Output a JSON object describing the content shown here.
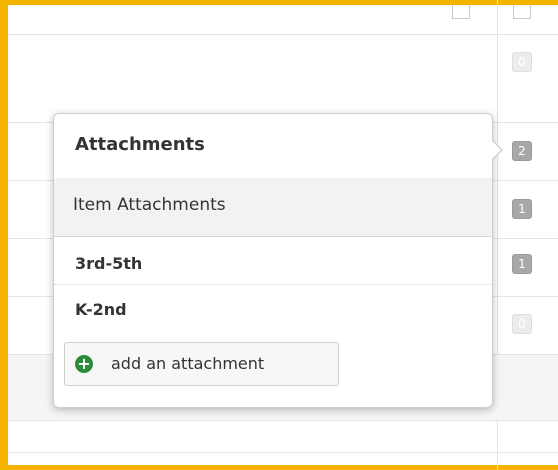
{
  "popover": {
    "title": "Attachments",
    "section_label": "Item Attachments",
    "items": [
      {
        "label": "3rd-5th"
      },
      {
        "label": "K-2nd"
      }
    ],
    "add_button_label": "add an attachment",
    "add_icon_glyph": "+"
  },
  "badges": [
    {
      "count": "0"
    },
    {
      "count": "2"
    },
    {
      "count": "1"
    },
    {
      "count": "1"
    },
    {
      "count": "0"
    }
  ],
  "colors": {
    "frame": "#f6b400",
    "add_icon": "#2e8b3c",
    "badge_active": "#a8a8a8",
    "badge_zero": "#ececec"
  }
}
